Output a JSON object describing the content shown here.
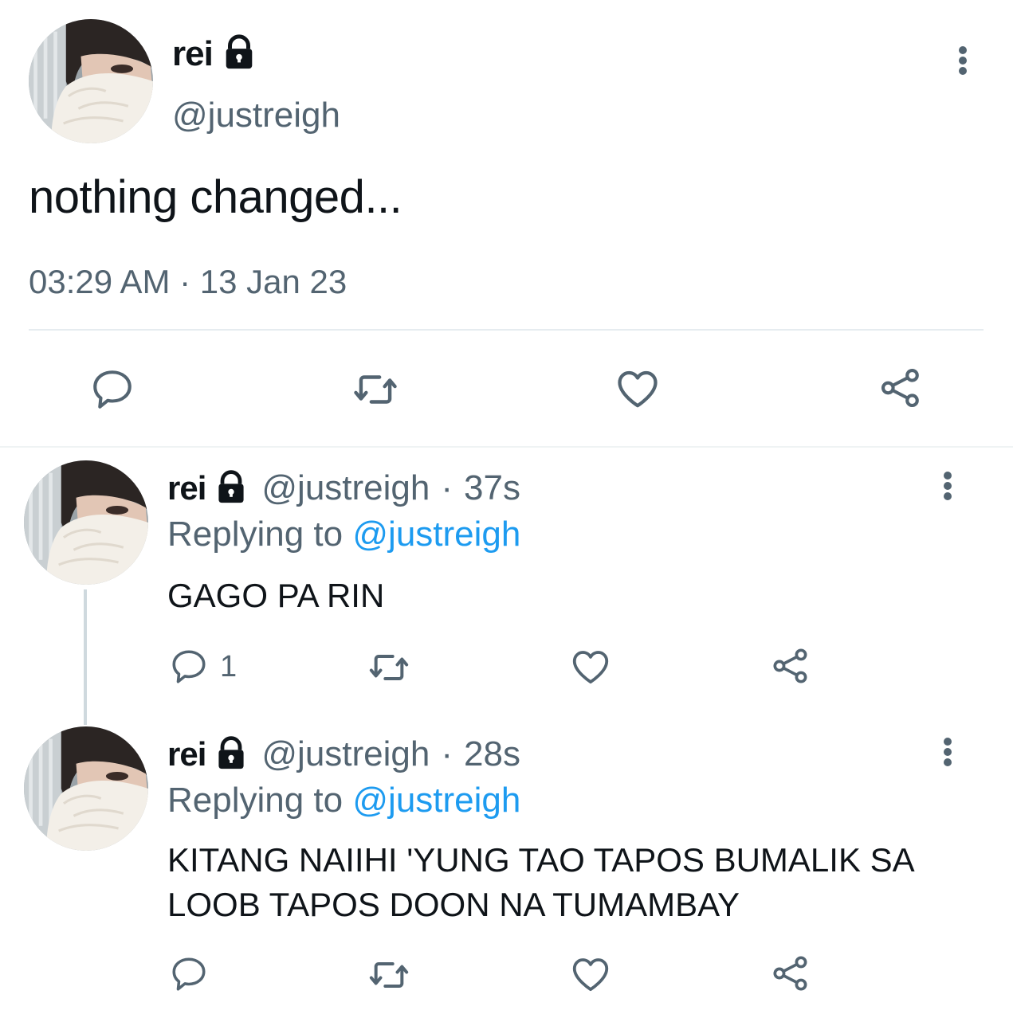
{
  "main_tweet": {
    "name": "rei",
    "handle": "@justreigh",
    "text": "nothing changed...",
    "timestamp": "03:29 AM · 13 Jan 23",
    "icons": [
      "lock-icon",
      "more-icon",
      "reply-icon",
      "retweet-icon",
      "like-icon",
      "share-icon"
    ]
  },
  "replies": [
    {
      "name": "rei",
      "handle": "@justreigh",
      "separator": "·",
      "time": "37s",
      "replying_prefix": "Replying to",
      "replying_handle": "@justreigh",
      "text": "GAGO PA RIN",
      "reply_count": "1"
    },
    {
      "name": "rei",
      "handle": "@justreigh",
      "separator": "·",
      "time": "28s",
      "replying_prefix": "Replying to",
      "replying_handle": "@justreigh",
      "text": "KITANG NAIIHI 'YUNG TAO TAPOS BUMALIK SA LOOB TAPOS DOON NA TUMAMBAY",
      "reply_count": ""
    }
  ],
  "colors": {
    "text": "#0f1419",
    "secondary": "#536471",
    "link": "#1d9bf0",
    "divider": "#e6ecf0"
  }
}
